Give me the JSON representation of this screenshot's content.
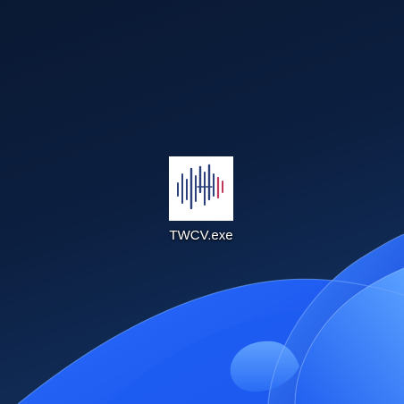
{
  "desktop": {
    "icons": [
      {
        "label": "TWCV.exe",
        "icon": "audio-waveform-app-icon",
        "colors": {
          "tile_background": "#ffffff",
          "bars_primary": "#2b3f7a",
          "bars_accent": "#c0395a"
        }
      }
    ],
    "wallpaper": {
      "style": "windows-11-bloom",
      "colors": {
        "background_dark": "#0a1933",
        "background_light": "#13376a",
        "bloom_blue": "#1f63f0",
        "bloom_highlight": "#4a8dff"
      }
    }
  }
}
